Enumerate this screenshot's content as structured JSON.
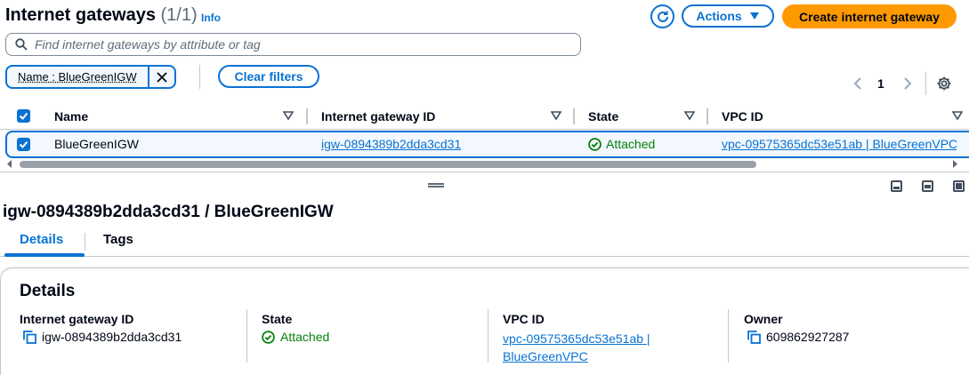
{
  "header": {
    "title": "Internet gateways",
    "count": "(1/1)",
    "info": "Info",
    "actions_label": "Actions",
    "create_label": "Create internet gateway"
  },
  "search": {
    "placeholder": "Find internet gateways by attribute or tag"
  },
  "filter": {
    "token": "Name : BlueGreenIGW",
    "clear_label": "Clear filters"
  },
  "pagination": {
    "current_page": "1"
  },
  "table": {
    "columns": [
      "Name",
      "Internet gateway ID",
      "State",
      "VPC ID"
    ],
    "rows": [
      {
        "name": "BlueGreenIGW",
        "gateway_id": "igw-0894389b2dda3cd31",
        "state": "Attached",
        "vpc_id": "vpc-09575365dc53e51ab | BlueGreenVPC"
      }
    ]
  },
  "details": {
    "title": "igw-0894389b2dda3cd31 / BlueGreenIGW",
    "tabs": [
      "Details",
      "Tags"
    ],
    "panel_title": "Details",
    "fields": {
      "gateway_id_label": "Internet gateway ID",
      "gateway_id_value": "igw-0894389b2dda3cd31",
      "state_label": "State",
      "state_value": "Attached",
      "vpc_label": "VPC ID",
      "vpc_value_line1": "vpc-09575365dc53e51ab |",
      "vpc_value_line2": "BlueGreenVPC",
      "owner_label": "Owner",
      "owner_value": "609862927287"
    }
  },
  "colors": {
    "accent": "#0972d3",
    "primary_button": "#ff9900",
    "success": "#037f0c"
  }
}
